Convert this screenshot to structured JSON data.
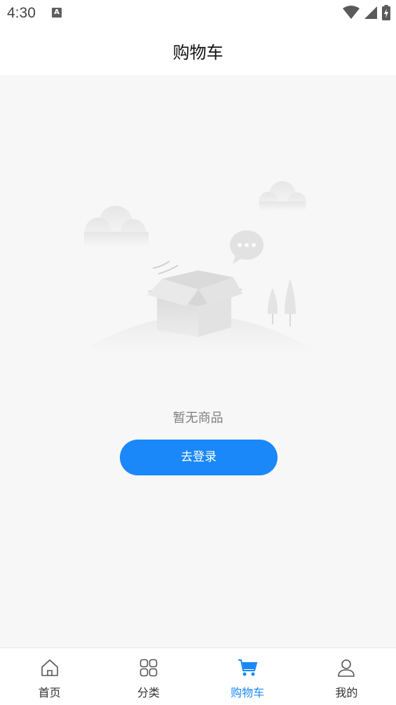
{
  "status_bar": {
    "time": "4:30",
    "notification_icon_letter": "A"
  },
  "header": {
    "title": "购物车"
  },
  "empty_state": {
    "message": "暂无商品",
    "login_button_label": "去登录"
  },
  "tabbar": {
    "accent_color": "#1a88f8",
    "items": [
      {
        "label": "首页",
        "icon": "home-icon",
        "active": false
      },
      {
        "label": "分类",
        "icon": "grid-icon",
        "active": false
      },
      {
        "label": "购物车",
        "icon": "cart-icon",
        "active": true
      },
      {
        "label": "我的",
        "icon": "user-icon",
        "active": false
      }
    ]
  }
}
